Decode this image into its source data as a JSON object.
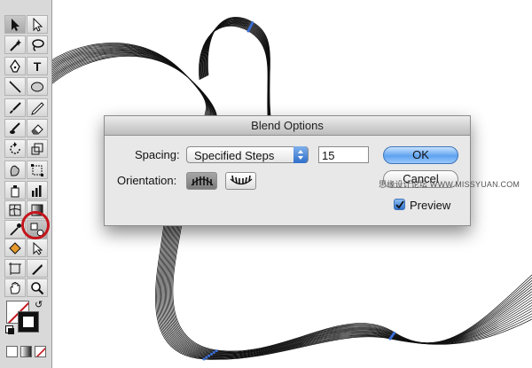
{
  "dialog": {
    "title": "Blend Options",
    "spacing_label": "Spacing:",
    "spacing_value": "Specified Steps",
    "steps_value": "15",
    "orientation_label": "Orientation:",
    "ok_label": "OK",
    "cancel_label": "Cancel",
    "preview_label": "Preview",
    "preview_checked": true
  },
  "toolbar": {
    "type_tool_label": "T",
    "highlighted_tool": "blend-tool",
    "highlight_color": "#c4151c"
  },
  "watermark": "思缘设计论坛 WWW.MISSYUAN.COM",
  "colors": {
    "accent_blue": "#3f74b8",
    "dialog_bg": "#e8e8e8",
    "panel_bg": "#d9d9d9"
  }
}
